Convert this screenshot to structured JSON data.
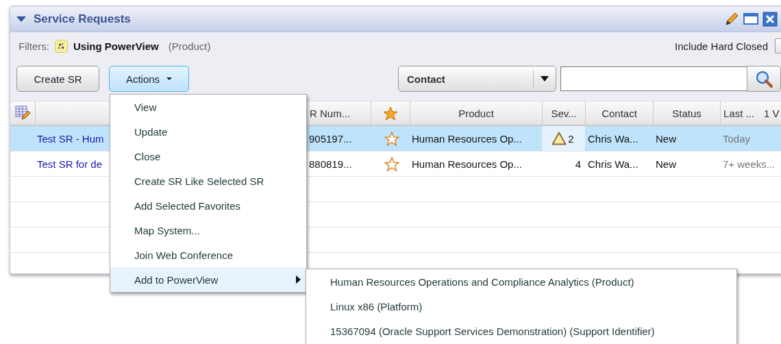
{
  "panel": {
    "title": "Service Requests",
    "expanded": true
  },
  "filters": {
    "label": "Filters:",
    "name": "Using PowerView",
    "qualifier": "(Product)",
    "include_hard_closed": {
      "label": "Include Hard Closed",
      "checked": false
    }
  },
  "toolbar": {
    "create_button": "Create SR",
    "actions_button": {
      "label": "Actions",
      "open": true
    },
    "search_by": "Contact"
  },
  "table": {
    "columns": [
      {
        "kind": "icon"
      },
      {
        "kind": "blank"
      },
      {
        "kind": "text",
        "label": "R Num..."
      },
      {
        "kind": "star"
      },
      {
        "kind": "text",
        "label": "Product"
      },
      {
        "kind": "text",
        "label": "Sev..."
      },
      {
        "kind": "text",
        "label": "Contact"
      },
      {
        "kind": "text",
        "label": "Status"
      },
      {
        "kind": "text",
        "label": "Last ...",
        "extra": "1 V"
      }
    ],
    "rows": [
      {
        "selected": true,
        "title": "Test SR - Hum",
        "sr_number": "905197...",
        "favorite": false,
        "product": "Human Resources Op...",
        "warning": true,
        "severity": "2",
        "contact": "Chris Wa...",
        "status": "New",
        "last_updated": "Today"
      },
      {
        "selected": false,
        "title": "Test SR for de",
        "sr_number": "880819...",
        "favorite": false,
        "product": "Human Resources Op...",
        "warning": false,
        "severity": "4",
        "contact": "Chris Wa...",
        "status": "New",
        "last_updated": "7+ weeks..."
      }
    ]
  },
  "menu": {
    "items": [
      {
        "label": "View",
        "selected": false,
        "has_submenu": false
      },
      {
        "label": "Update",
        "selected": false,
        "has_submenu": false
      },
      {
        "label": "Close",
        "selected": false,
        "has_submenu": false
      },
      {
        "label": "Create SR Like Selected SR",
        "selected": false,
        "has_submenu": false
      },
      {
        "label": "Add Selected Favorites",
        "selected": false,
        "has_submenu": false
      },
      {
        "label": "Map System...",
        "selected": false,
        "has_submenu": false
      },
      {
        "label": "Join Web Conference",
        "selected": false,
        "has_submenu": false
      },
      {
        "label": "Add to PowerView",
        "selected": true,
        "has_submenu": true
      }
    ],
    "submenu": [
      "Human Resources Operations and Compliance Analytics (Product)",
      "Linux x86 (Platform)",
      "15367094 (Oracle Support Services Demonstration) (Support Identifier)"
    ]
  }
}
